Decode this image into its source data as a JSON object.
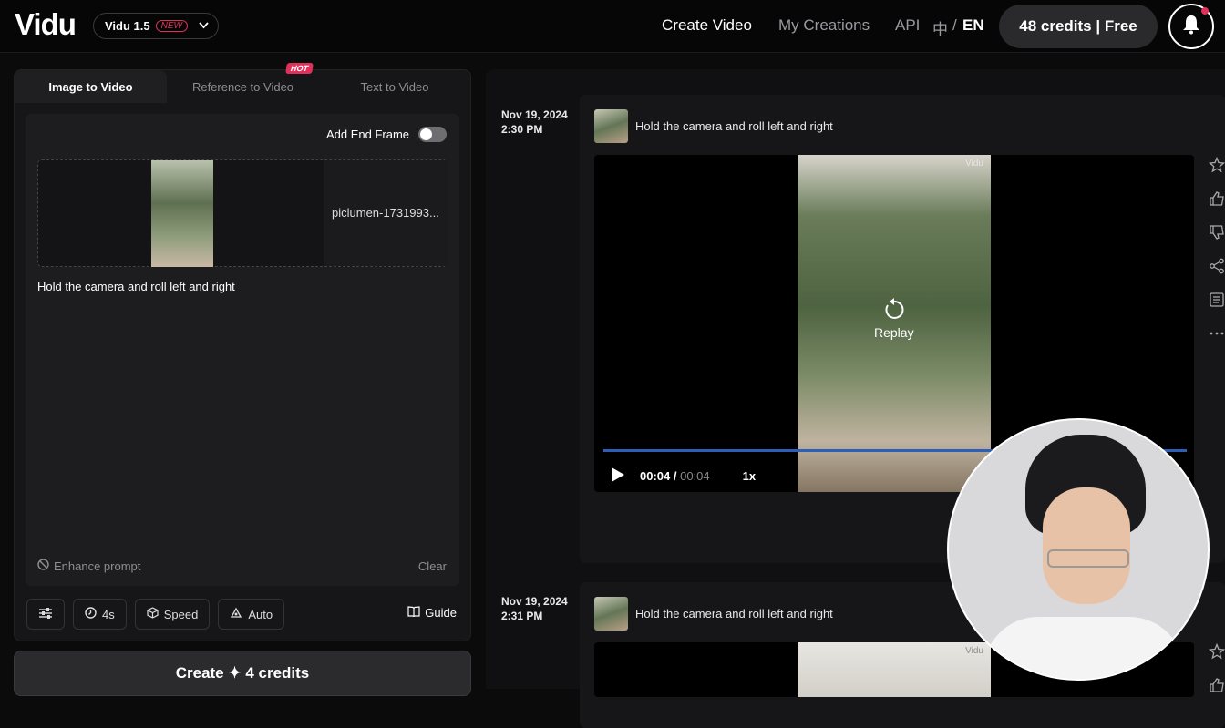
{
  "header": {
    "logo": "Vidu",
    "version": "Vidu 1.5",
    "version_badge": "NEW",
    "nav": [
      "Create Video",
      "My Creations",
      "API"
    ],
    "lang_cn": "中",
    "lang_sep": "/",
    "lang_en": "EN",
    "credits": "48 credits | Free"
  },
  "left": {
    "tabs": [
      {
        "label": "Image to Video",
        "active": true
      },
      {
        "label": "Reference to Video",
        "active": false
      },
      {
        "label": "Text to Video",
        "active": false
      }
    ],
    "hot_badge": "HOT",
    "end_frame_label": "Add End Frame",
    "file_name": "piclumen-1731993...",
    "prompt": "Hold the camera and roll left and right",
    "enhance_label": "Enhance prompt",
    "clear_label": "Clear",
    "options": {
      "duration": "4s",
      "mode": "Speed",
      "movement": "Auto"
    },
    "guide_label": "Guide",
    "create_label": "Create ✦ 4 credits"
  },
  "feed": [
    {
      "date": "Nov 19, 2024",
      "time": "2:30 PM",
      "prompt": "Hold the camera and roll left and right",
      "watermark": "Vidu",
      "replay": "Replay",
      "time_current": "00:04",
      "time_total": "00:04",
      "speed": "1x"
    },
    {
      "date": "Nov 19, 2024",
      "time": "2:31 PM",
      "prompt": "Hold the camera and roll left and right",
      "watermark": "Vidu"
    }
  ],
  "colors": {
    "accent": "#e0315a",
    "progress": "#2e5fb8",
    "panel": "#161618"
  }
}
